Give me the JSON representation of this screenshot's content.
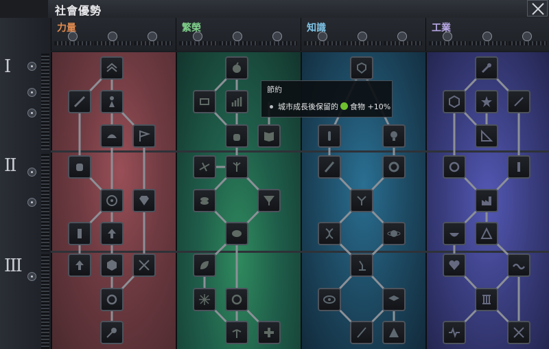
{
  "window": {
    "title": "社會優勢"
  },
  "tiers": [
    "I",
    "II",
    "III"
  ],
  "columns": [
    {
      "id": "power",
      "title": "力量",
      "color": "#e18a4f"
    },
    {
      "id": "prosperity",
      "title": "繁榮",
      "color": "#7fd08a"
    },
    {
      "id": "knowledge",
      "title": "知識",
      "color": "#7fc3e6"
    },
    {
      "id": "industry",
      "title": "工業",
      "color": "#b9a9e6"
    }
  ],
  "colors": {
    "power_bg": "#6e3a41",
    "prosperity_bg": "#1f5e4a",
    "knowledge_bg": "#1d4a63",
    "industry_bg": "#3a3e80",
    "node_border": "#4c525b",
    "link": "#8c9097"
  },
  "tooltip": {
    "title": "節約",
    "text_before": "城市成長後保留的",
    "icon": "food-icon",
    "text_after": "食物 +10%"
  }
}
